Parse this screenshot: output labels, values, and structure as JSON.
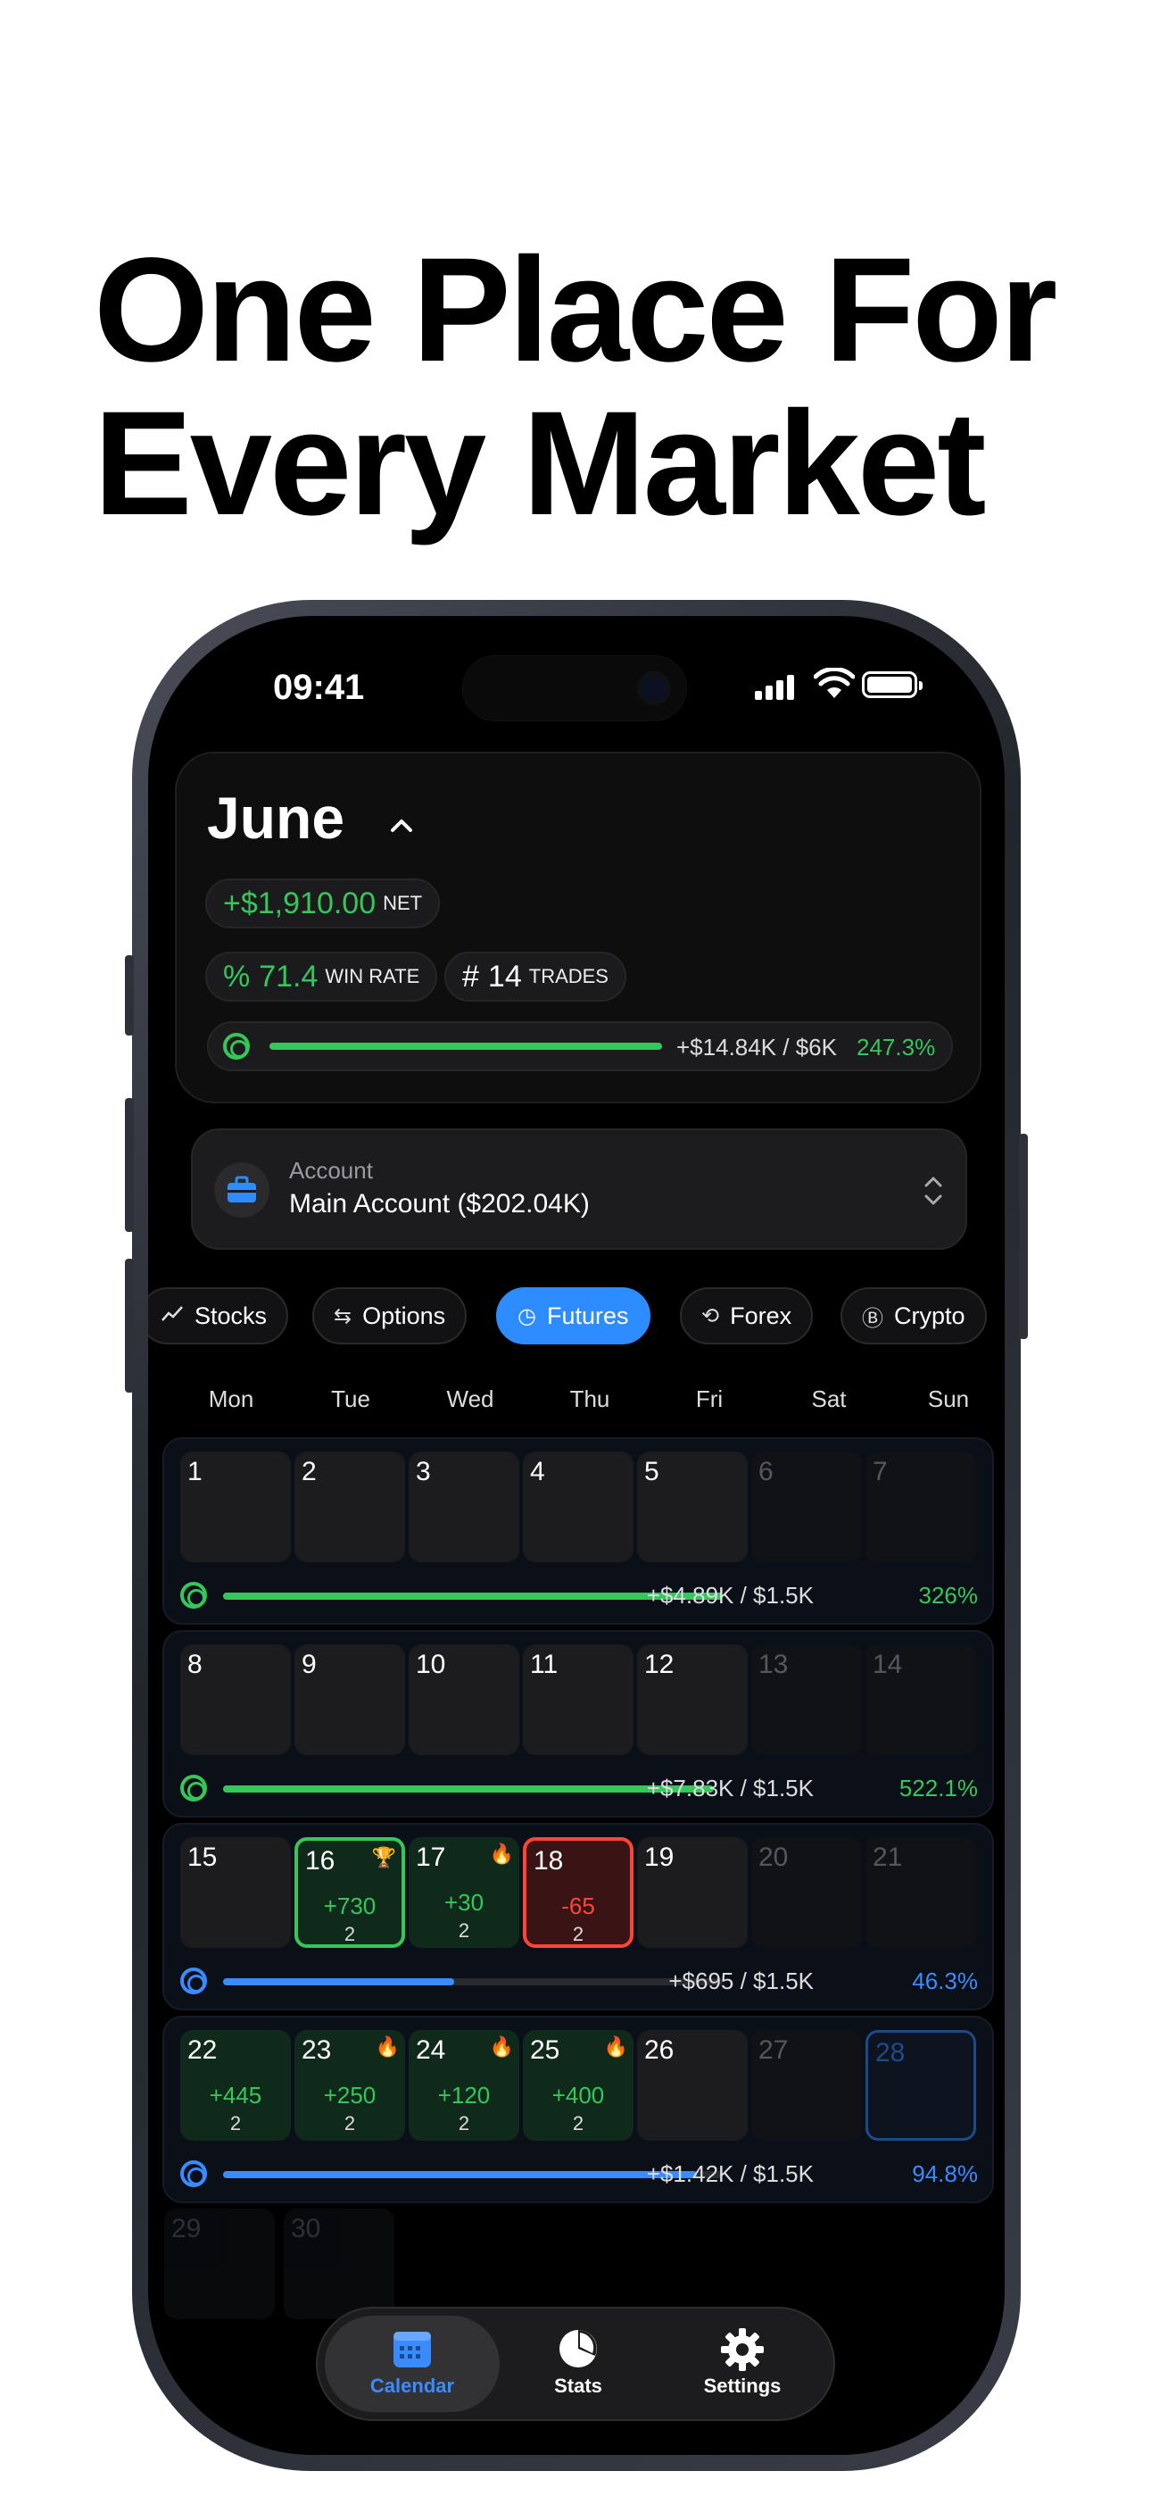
{
  "headline": {
    "line1": "One Place For",
    "line2": "Every Market"
  },
  "status_bar": {
    "time": "09:41"
  },
  "month_card": {
    "month": "June",
    "net_value": "+$1,910.00",
    "net_label": "NET",
    "win_rate_symbol": "%",
    "win_rate_value": "71.4",
    "win_rate_label": "WIN RATE",
    "trades_symbol": "#",
    "trades_value": "14",
    "trades_label": "TRADES",
    "goal_text": "+$14.84K / $6K",
    "goal_pct": "247.3%",
    "goal_progress": 1.0
  },
  "account": {
    "label": "Account",
    "value": "Main Account ($202.04K)"
  },
  "markets": [
    {
      "label": "Stocks",
      "icon": "chart-icon"
    },
    {
      "label": "Options",
      "icon": "swap-icon"
    },
    {
      "label": "Futures",
      "icon": "history-icon",
      "active": true
    },
    {
      "label": "Forex",
      "icon": "currency-exchange-icon"
    },
    {
      "label": "Crypto",
      "icon": "bitcoin-icon"
    }
  ],
  "weekdays": [
    "Mon",
    "Tue",
    "Wed",
    "Thu",
    "Fri",
    "Sat",
    "Sun"
  ],
  "weeks": [
    {
      "days": [
        "1",
        "2",
        "3",
        "4",
        "5",
        "6",
        "7"
      ],
      "goal_text": "+$4.89K / $1.5K",
      "goal_pct": "326%",
      "progress": 1.0,
      "color": "green"
    },
    {
      "days": [
        "8",
        "9",
        "10",
        "11",
        "12",
        "13",
        "14"
      ],
      "goal_text": "+$7.83K / $1.5K",
      "goal_pct": "522.1%",
      "progress": 1.0,
      "color": "green"
    },
    {
      "days": [
        "15",
        "16",
        "17",
        "18",
        "19",
        "20",
        "21"
      ],
      "goal_text": "+$695 / $1.5K",
      "goal_pct": "46.3%",
      "progress": 0.463,
      "color": "blue",
      "details": {
        "16": {
          "pnl": "+730",
          "count": "2",
          "badge": "trophy-icon",
          "style": "win-b"
        },
        "17": {
          "pnl": "+30",
          "count": "2",
          "badge": "fire-icon",
          "style": "win"
        },
        "18": {
          "pnl": "-65",
          "count": "2",
          "style": "loss-b"
        }
      }
    },
    {
      "days": [
        "22",
        "23",
        "24",
        "25",
        "26",
        "27",
        "28"
      ],
      "goal_text": "+$1.42K / $1.5K",
      "goal_pct": "94.8%",
      "progress": 0.948,
      "color": "blue",
      "details": {
        "22": {
          "pnl": "+445",
          "count": "2",
          "style": "win"
        },
        "23": {
          "pnl": "+250",
          "count": "2",
          "badge": "fire-icon",
          "style": "win"
        },
        "24": {
          "pnl": "+120",
          "count": "2",
          "badge": "fire-icon",
          "style": "win"
        },
        "25": {
          "pnl": "+400",
          "count": "2",
          "badge": "fire-icon",
          "style": "win"
        },
        "28": {
          "style": "today"
        }
      }
    }
  ],
  "trailing_days": [
    "29",
    "30"
  ],
  "tab_bar": [
    {
      "label": "Calendar",
      "icon": "calendar-icon",
      "active": true
    },
    {
      "label": "Stats",
      "icon": "pie-chart-icon"
    },
    {
      "label": "Settings",
      "icon": "gear-icon"
    }
  ],
  "colors": {
    "green": "#35c75a",
    "blue": "#3a8bff",
    "red": "#ff453a",
    "accent": "#2d8cff"
  }
}
